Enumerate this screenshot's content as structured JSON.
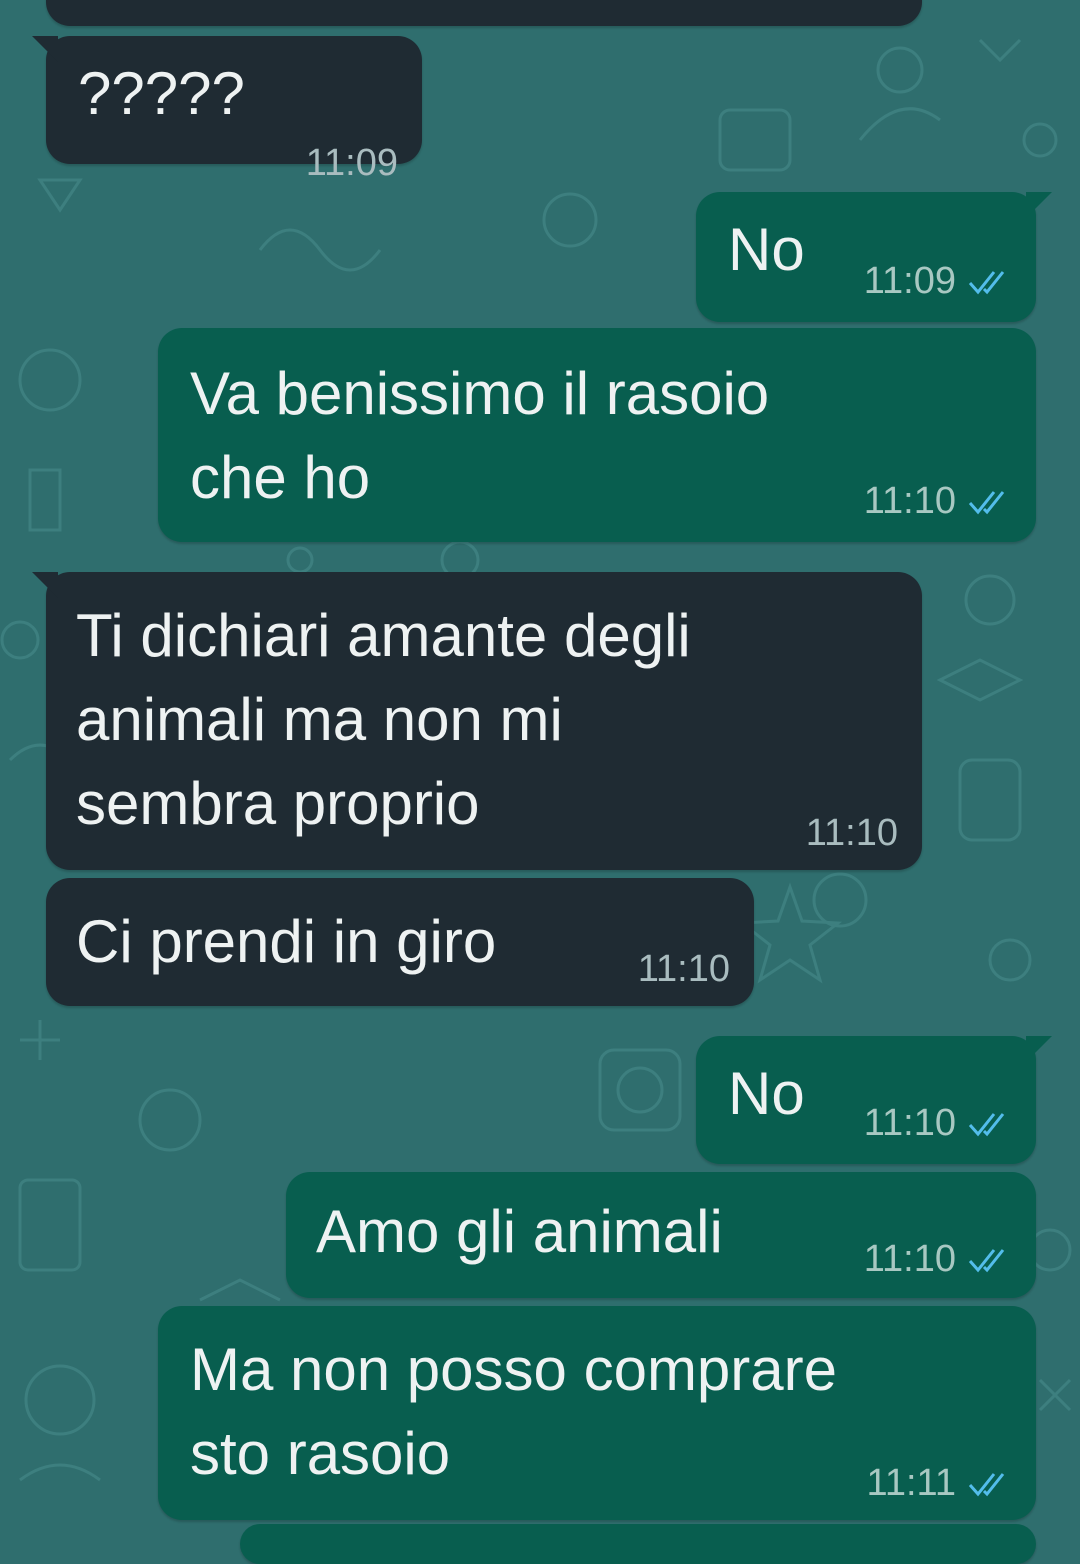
{
  "colors": {
    "wallpaper": "#2f6e6e",
    "incoming_bubble": "#1f2b33",
    "outgoing_bubble": "#085e4f",
    "read_ticks": "#53bdeb"
  },
  "messages": [
    {
      "direction": "in",
      "text": "?????",
      "time": "11:09"
    },
    {
      "direction": "out",
      "text": "No",
      "time": "11:09",
      "status": "read"
    },
    {
      "direction": "out",
      "text": "Va benissimo il rasoio\nche ho",
      "time": "11:10",
      "status": "read"
    },
    {
      "direction": "in",
      "text": "Ti dichiari amante degli\nanimali ma non mi\nsembra proprio",
      "time": "11:10"
    },
    {
      "direction": "in",
      "text": "Ci prendi in giro",
      "time": "11:10"
    },
    {
      "direction": "out",
      "text": "No",
      "time": "11:10",
      "status": "read"
    },
    {
      "direction": "out",
      "text": "Amo gli animali",
      "time": "11:10",
      "status": "read"
    },
    {
      "direction": "out",
      "text": "Ma non posso comprare\nsto rasoio",
      "time": "11:11",
      "status": "read"
    }
  ],
  "icons": {
    "read_receipt": "double-check-icon"
  }
}
